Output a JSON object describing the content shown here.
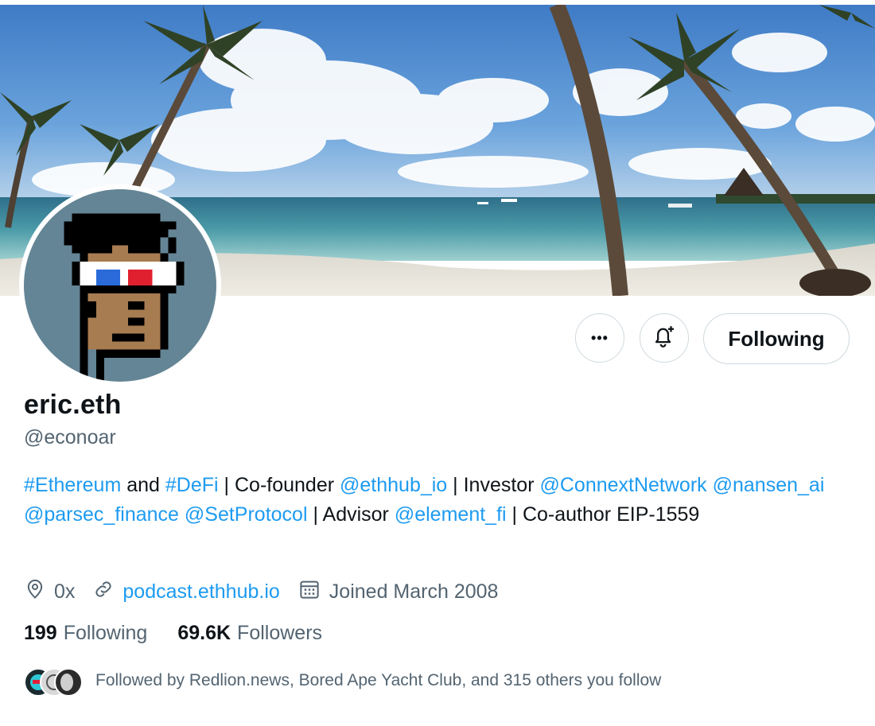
{
  "profile": {
    "display_name": "eric.eth",
    "handle": "@econoar",
    "following_button": "Following",
    "more_button": "•••"
  },
  "bio": {
    "parts": [
      {
        "text": "#Ethereum",
        "type": "link"
      },
      {
        "text": " and ",
        "type": "text"
      },
      {
        "text": "#DeFi",
        "type": "link"
      },
      {
        "text": " | Co-founder ",
        "type": "text"
      },
      {
        "text": "@ethhub_io",
        "type": "link"
      },
      {
        "text": " | Investor ",
        "type": "text"
      },
      {
        "text": "@ConnextNetwork",
        "type": "link"
      },
      {
        "text": " ",
        "type": "text"
      },
      {
        "text": "@nansen_ai",
        "type": "link"
      },
      {
        "text": " ",
        "type": "text"
      },
      {
        "text": "@parsec_finance",
        "type": "link"
      },
      {
        "text": " ",
        "type": "text"
      },
      {
        "text": "@SetProtocol",
        "type": "link"
      },
      {
        "text": " | Advisor ",
        "type": "text"
      },
      {
        "text": "@element_fi",
        "type": "link"
      },
      {
        "text": " | Co-author EIP-1559",
        "type": "text"
      }
    ]
  },
  "meta": {
    "location": "0x",
    "website": "podcast.ethhub.io",
    "joined": "Joined March 2008"
  },
  "stats": {
    "following_count": "199",
    "following_label": "Following",
    "followers_count": "69.6K",
    "followers_label": "Followers"
  },
  "followed_by": {
    "text": "Followed by Redlion.news, Bored Ape Yacht Club, and 315 others you follow"
  },
  "colors": {
    "accent": "#1d9bf0",
    "secondary_text": "#536471",
    "primary_text": "#0f1419",
    "border": "#cfd9de"
  },
  "icons": {
    "more": "more-dots-icon",
    "bell": "bell-plus-icon",
    "location": "location-pin-icon",
    "link": "link-icon",
    "calendar": "calendar-icon"
  }
}
